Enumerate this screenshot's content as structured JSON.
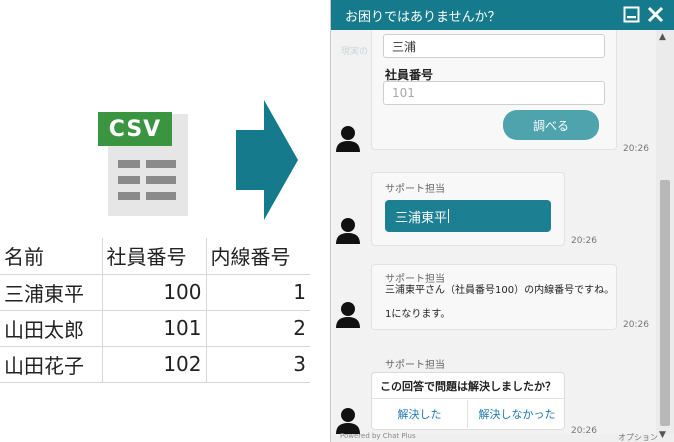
{
  "csv_icon": {
    "label": "CSV",
    "badge_color": "#3a9440"
  },
  "arrow_color": "#157a8c",
  "table": {
    "headers": [
      "名前",
      "社員番号",
      "内線番号"
    ],
    "rows": [
      [
        "三浦東平",
        "100",
        "1"
      ],
      [
        "山田太郎",
        "101",
        "2"
      ],
      [
        "山田花子",
        "102",
        "3"
      ]
    ]
  },
  "chat": {
    "header_title": "お困りではありませんか？",
    "accent_color": "#157a8c",
    "minimize_icon": "minimize-icon",
    "close_icon": "close-icon",
    "faint_background_text": "現実の",
    "form": {
      "name_value": "三浦",
      "emp_label": "社員番号",
      "emp_placeholder": "101",
      "search_button": "調べる",
      "time": "20:26"
    },
    "msg1": {
      "sender": "サポート担当",
      "value": "三浦東平",
      "time": "20:26"
    },
    "msg2": {
      "sender": "サポート担当",
      "line1": "三浦東平さん（社員番号100）の内線番号ですね。",
      "line2": "1になります。",
      "time": "20:26"
    },
    "msg3": {
      "sender": "サポート担当",
      "question": "この回答で問題は解決しましたか？",
      "option_yes": "解決した",
      "option_no": "解決しなかった",
      "time": "20:26"
    },
    "footer_left": "Powered by Chat Plus",
    "footer_right": "オプション"
  }
}
